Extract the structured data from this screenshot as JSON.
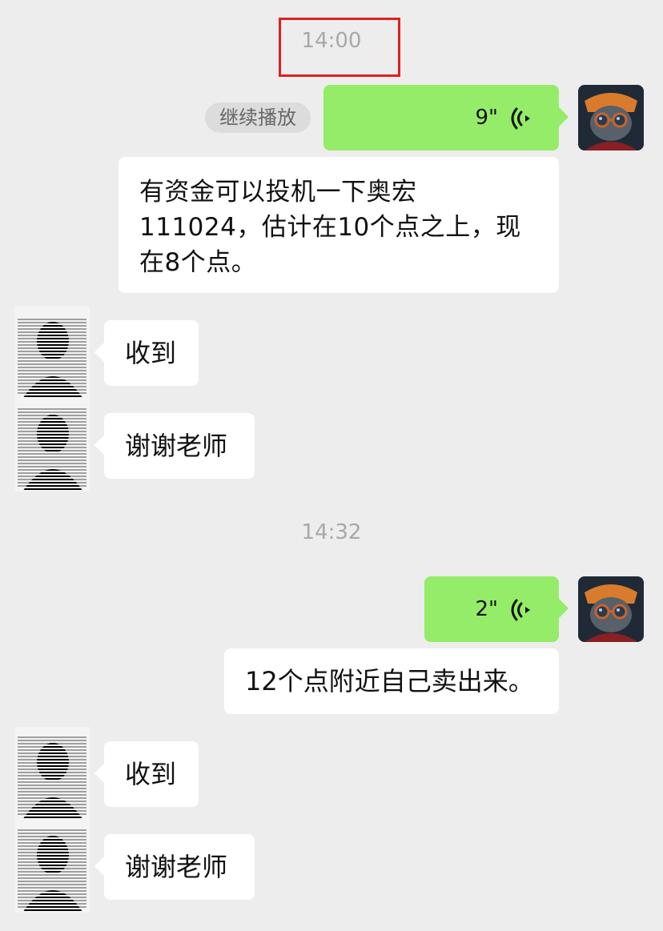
{
  "chat": {
    "timestamp_1": "14:00",
    "timestamp_2": "14:32",
    "continue_play_label": "继续播放",
    "voice_1_duration": "9\"",
    "voice_2_duration": "2\"",
    "message_1": "有资金可以投机一下奥宏111024，估计在10个点之上，现在8个点。",
    "reply_1": "收到",
    "reply_2": "谢谢老师",
    "message_2": "12个点附近自己卖出来。",
    "reply_3": "收到",
    "reply_4": "谢谢老师"
  },
  "colors": {
    "background": "#ededed",
    "sent_bubble": "#95ec69",
    "received_bubble": "#ffffff",
    "highlight_box": "#e02020",
    "timestamp_text": "#a8a8a8"
  },
  "icons": {
    "voice": "voice-wave-icon",
    "my_avatar": "cat-with-glasses-avatar",
    "other_avatar": "blurred-avatar"
  }
}
